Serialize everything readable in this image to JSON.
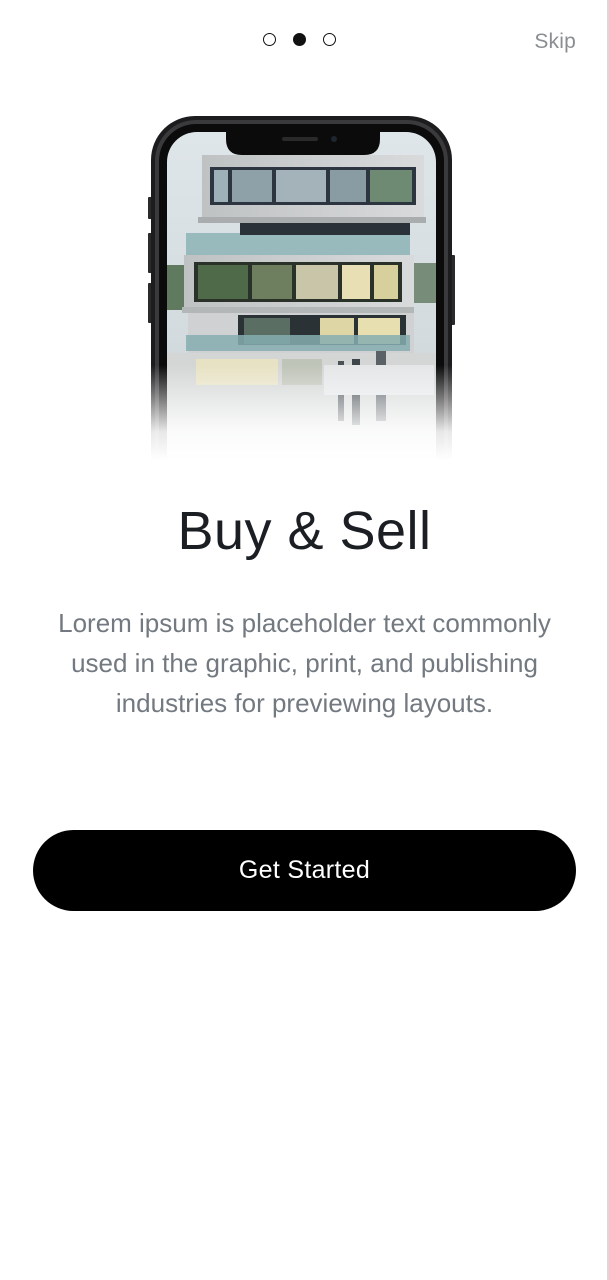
{
  "header": {
    "pager": {
      "count": 3,
      "active_index": 1
    },
    "skip_label": "Skip"
  },
  "hero": {
    "image": "phone-mockup-modern-building"
  },
  "onboarding": {
    "title": "Buy & Sell",
    "description": "Lorem ipsum is placeholder text commonly used in the graphic, print, and publishing industries for previewing layouts."
  },
  "cta": {
    "label": "Get Started"
  },
  "colors": {
    "background": "#ffffff",
    "title": "#1b1f24",
    "description": "#737980",
    "button_bg": "#000000",
    "button_text": "#ffffff",
    "skip": "#8a8e93"
  }
}
